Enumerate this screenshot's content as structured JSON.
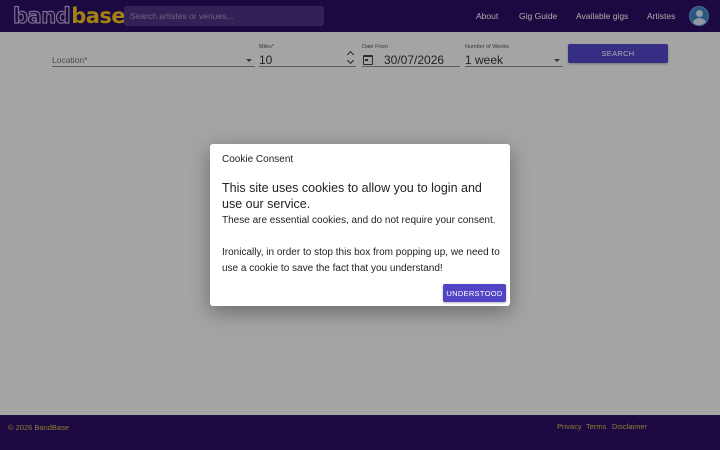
{
  "header": {
    "logo_band": "band",
    "logo_base": "base",
    "search_placeholder": "Search artistes or venues...",
    "nav": [
      "About",
      "Gig Guide",
      "Available gigs",
      "Artistes"
    ],
    "avatar_icon": "user-avatar-icon"
  },
  "filters": {
    "location_placeholder": "Location*",
    "miles_label": "Miles*",
    "miles_value": "10",
    "date_label": "Date From",
    "date_value": "30/07/2026",
    "weeks_label": "Number of Weeks",
    "weeks_value": "1 week",
    "search_label": "SEARCH"
  },
  "dialog": {
    "title": "Cookie Consent",
    "main": "This site uses cookies to allow you to login and use our service.",
    "p1": "These are essential cookies, and do not require your consent.",
    "p2": "Ironically, in order to stop this box from popping up, we need to use a cookie to save the fact that you understand!",
    "button": "UNDERSTOOD"
  },
  "footer": {
    "copyright": "© 2026 BandBase",
    "links": [
      "Privacy",
      "Terms",
      "Disclaimer"
    ]
  },
  "colors": {
    "header_bg": "#2a0e61",
    "accent": "#5145c6",
    "logo_yellow": "#f2c21c",
    "footer_text": "#d8b94a"
  }
}
